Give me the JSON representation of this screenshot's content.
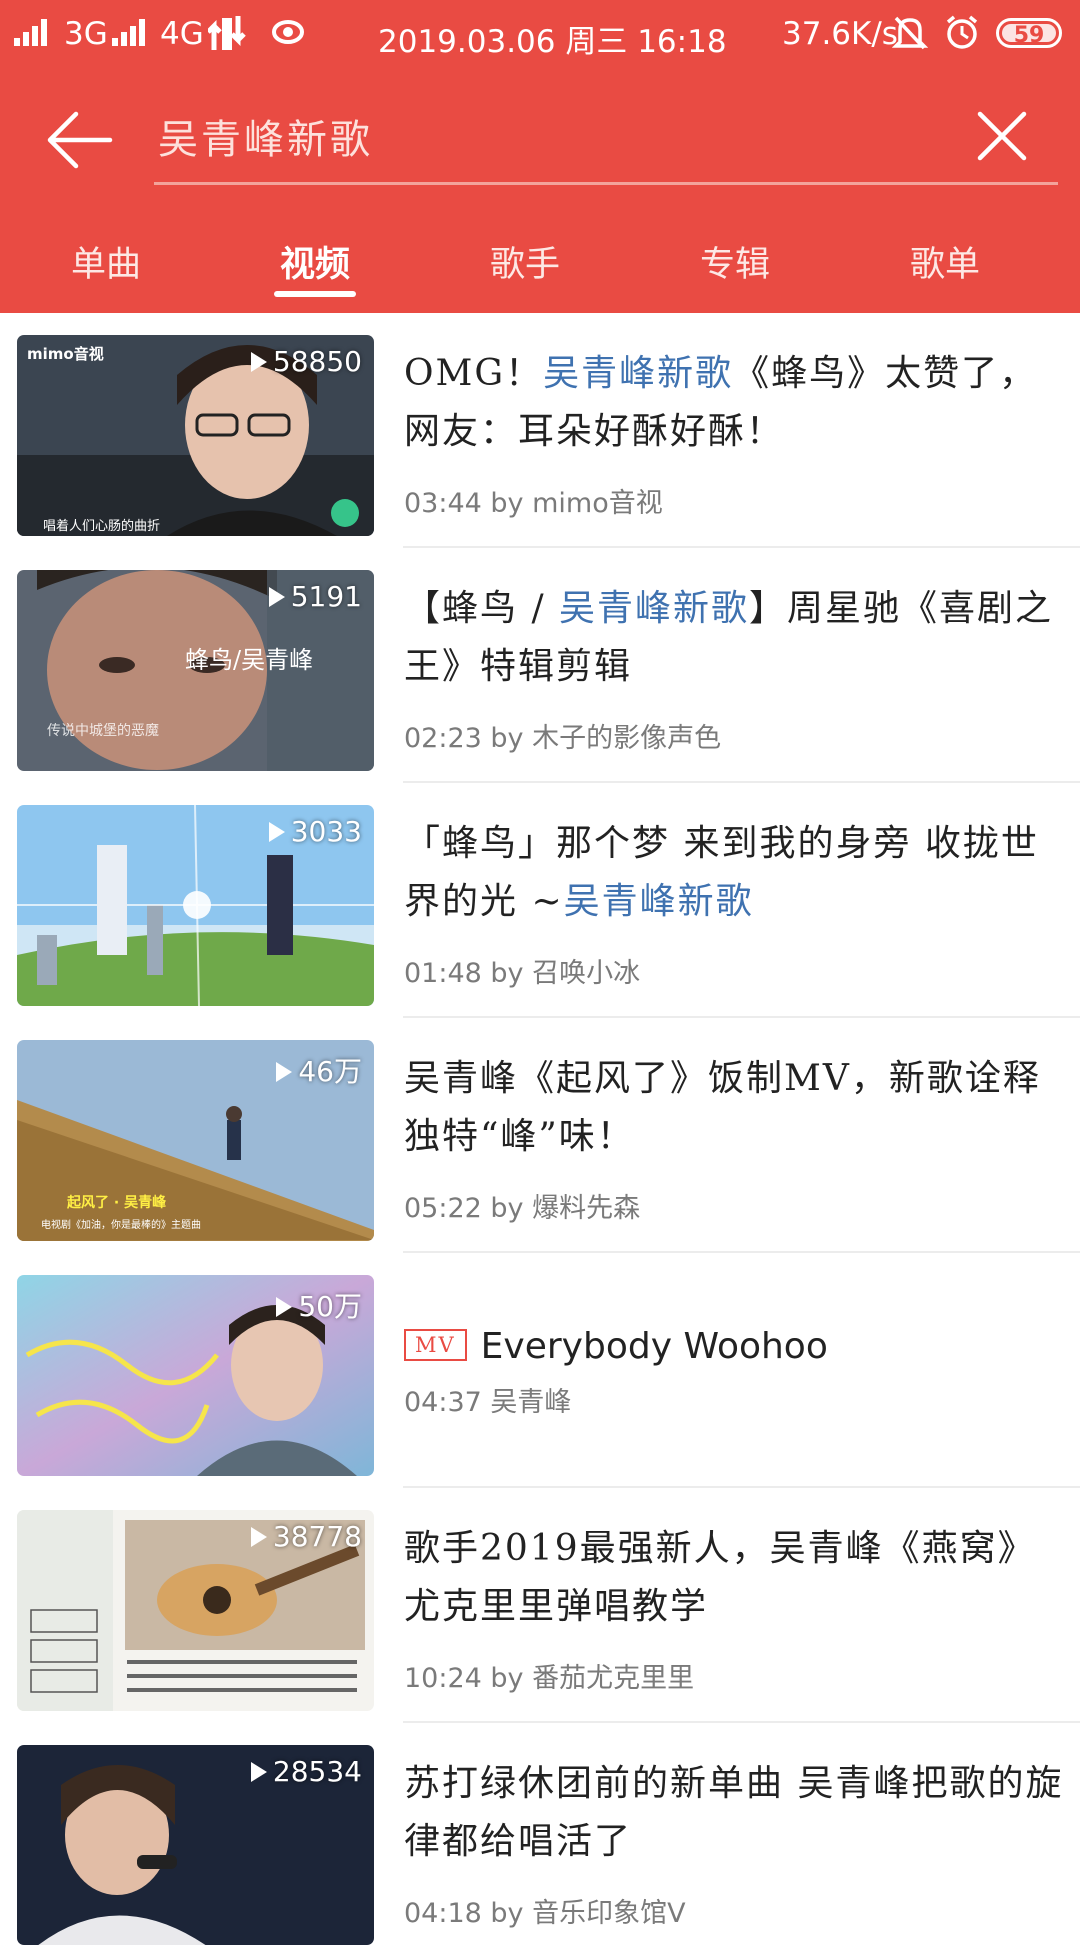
{
  "status_bar": {
    "network_1": "3G",
    "network_2": "4G",
    "datetime": "2019.03.06 周三 16:18",
    "speed": "37.6K/s",
    "battery": "59"
  },
  "search": {
    "query": "吴青峰新歌"
  },
  "tabs": [
    {
      "label": "单曲",
      "active": false
    },
    {
      "label": "视频",
      "active": true
    },
    {
      "label": "歌手",
      "active": false
    },
    {
      "label": "专辑",
      "active": false
    },
    {
      "label": "歌单",
      "active": false
    }
  ],
  "results": [
    {
      "count": "58850",
      "title_pre": "OMG！",
      "title_hl": "吴青峰新歌",
      "title_post": "《蜂鸟》太赞了，网友：耳朵好酥好酥！",
      "duration": "03:44",
      "by": "by",
      "author": "mimo音视",
      "thumb_badge": "mimo音视",
      "thumb_caption": "唱着人们心肠的曲折"
    },
    {
      "count": "5191",
      "title_pre": "【蜂鸟 / ",
      "title_hl": "吴青峰新歌",
      "title_post": "】周星驰《喜剧之王》特辑剪辑",
      "duration": "02:23",
      "by": "by",
      "author": "木子的影像声色",
      "thumb_text_1": "蜂鸟/吴青峰",
      "thumb_text_2": "传说中城堡的恶魔"
    },
    {
      "count": "3033",
      "title_pre": "「蜂鸟」那个梦 来到我的身旁 收拢世界的光 ~",
      "title_hl": "吴青峰新歌",
      "title_post": "",
      "duration": "01:48",
      "by": "by",
      "author": "召唤小冰"
    },
    {
      "count": "46万",
      "title_pre": "吴青峰《起风了》饭制MV，新歌诠释独特“峰”味！",
      "title_hl": "",
      "title_post": "",
      "duration": "05:22",
      "by": "by",
      "author": "爆料先森",
      "thumb_text_1": "起风了 · 吴青峰",
      "thumb_text_2": "电视剧《加油，你是最棒的》主题曲"
    },
    {
      "count": "50万",
      "badge": "MV",
      "title": "Everybody Woohoo",
      "duration": "04:37",
      "author": "吴青峰"
    },
    {
      "count": "38778",
      "title_pre": "歌手2019最强新人，吴青峰《燕窝》尤克里里弹唱教学",
      "title_hl": "",
      "title_post": "",
      "duration": "10:24",
      "by": "by",
      "author": "番茄尤克里里"
    },
    {
      "count": "28534",
      "title_pre": "苏打绿休团前的新单曲 吴青峰把歌的旋律都给唱活了",
      "title_hl": "",
      "title_post": "",
      "duration": "04:18",
      "by": "by",
      "author": "音乐印象馆V"
    }
  ]
}
